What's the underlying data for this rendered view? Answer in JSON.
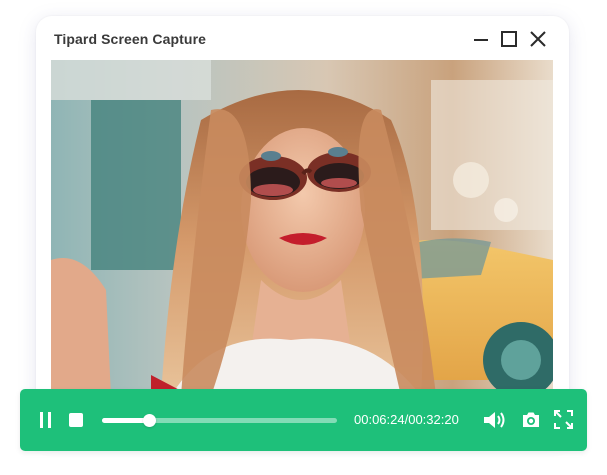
{
  "window": {
    "title": "Tipard Screen Capture",
    "controls": [
      "minimize-icon",
      "maximize-icon",
      "close-icon"
    ]
  },
  "video": {
    "content": "photo-frame"
  },
  "player": {
    "time_display": "00:06:24/00:32:20",
    "progress_fraction": 0.2,
    "state": "playing",
    "buttons": [
      "pause-icon",
      "stop-icon",
      "volume-icon",
      "camera-icon",
      "fullscreen-icon"
    ]
  },
  "colors": {
    "accent": "#1ec07a",
    "title_text": "#3a3a3a",
    "window_bg": "#ffffff"
  }
}
